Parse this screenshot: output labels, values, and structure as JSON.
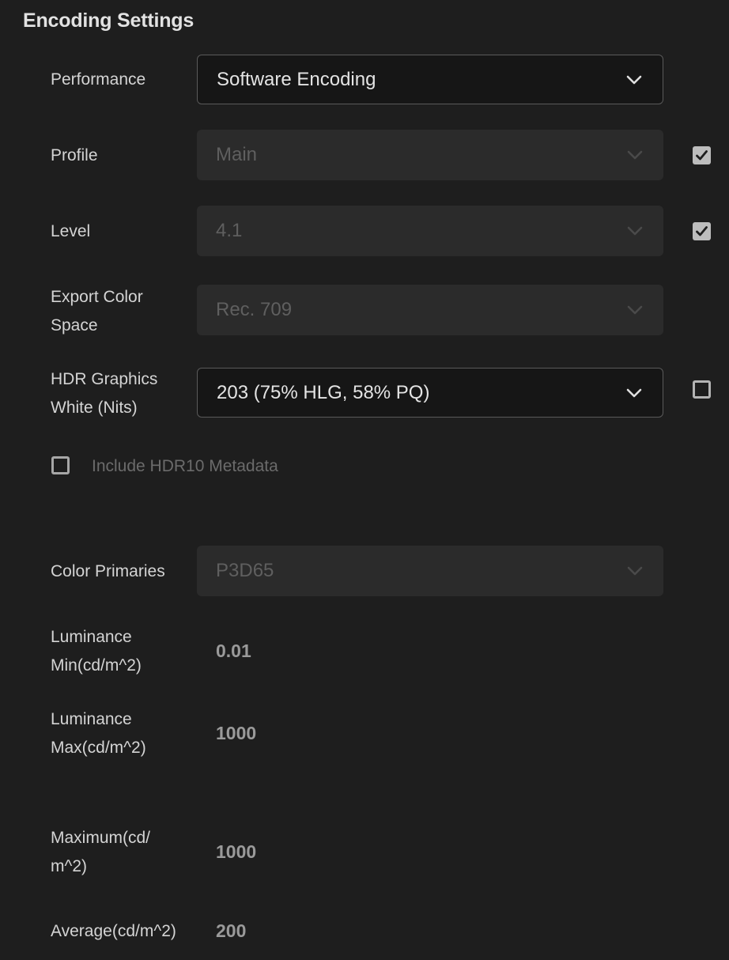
{
  "panel": {
    "title": "Encoding Settings"
  },
  "performance": {
    "label": "Performance",
    "value": "Software Encoding"
  },
  "profile": {
    "label": "Profile",
    "value": "Main",
    "override_checked": true
  },
  "level": {
    "label": "Level",
    "value": "4.1",
    "override_checked": true
  },
  "export_color_space": {
    "label_line1": "Export Color",
    "label_line2": "Space",
    "value": "Rec. 709"
  },
  "hdr_graphics_white": {
    "label_line1": "HDR Graphics",
    "label_line2": "White (Nits)",
    "value": "203 (75% HLG, 58% PQ)",
    "override_checked": false
  },
  "hdr10_metadata": {
    "label": "Include HDR10 Metadata",
    "checked": false
  },
  "color_primaries": {
    "label": "Color Primaries",
    "value": "P3D65"
  },
  "luminance_min": {
    "label_line1": "Luminance",
    "label_line2": "Min(cd/m^2)",
    "value": "0.01"
  },
  "luminance_max": {
    "label_line1": "Luminance",
    "label_line2": "Max(cd/m^2)",
    "value": "1000"
  },
  "maximum": {
    "label_line1": "Maximum(cd/",
    "label_line2": "m^2)",
    "value": "1000"
  },
  "average": {
    "label": "Average(cd/m^2)",
    "value": "200"
  },
  "icons": {
    "dropdown_chevron": "chevron-down-icon",
    "checkmark": "checkmark-icon"
  },
  "colors": {
    "background": "#1e1e1e",
    "enabled_field": "#161616",
    "disabled_field": "#2b2b2b",
    "text": "#d4d4d4",
    "disabled_text": "#5f5f5f"
  }
}
